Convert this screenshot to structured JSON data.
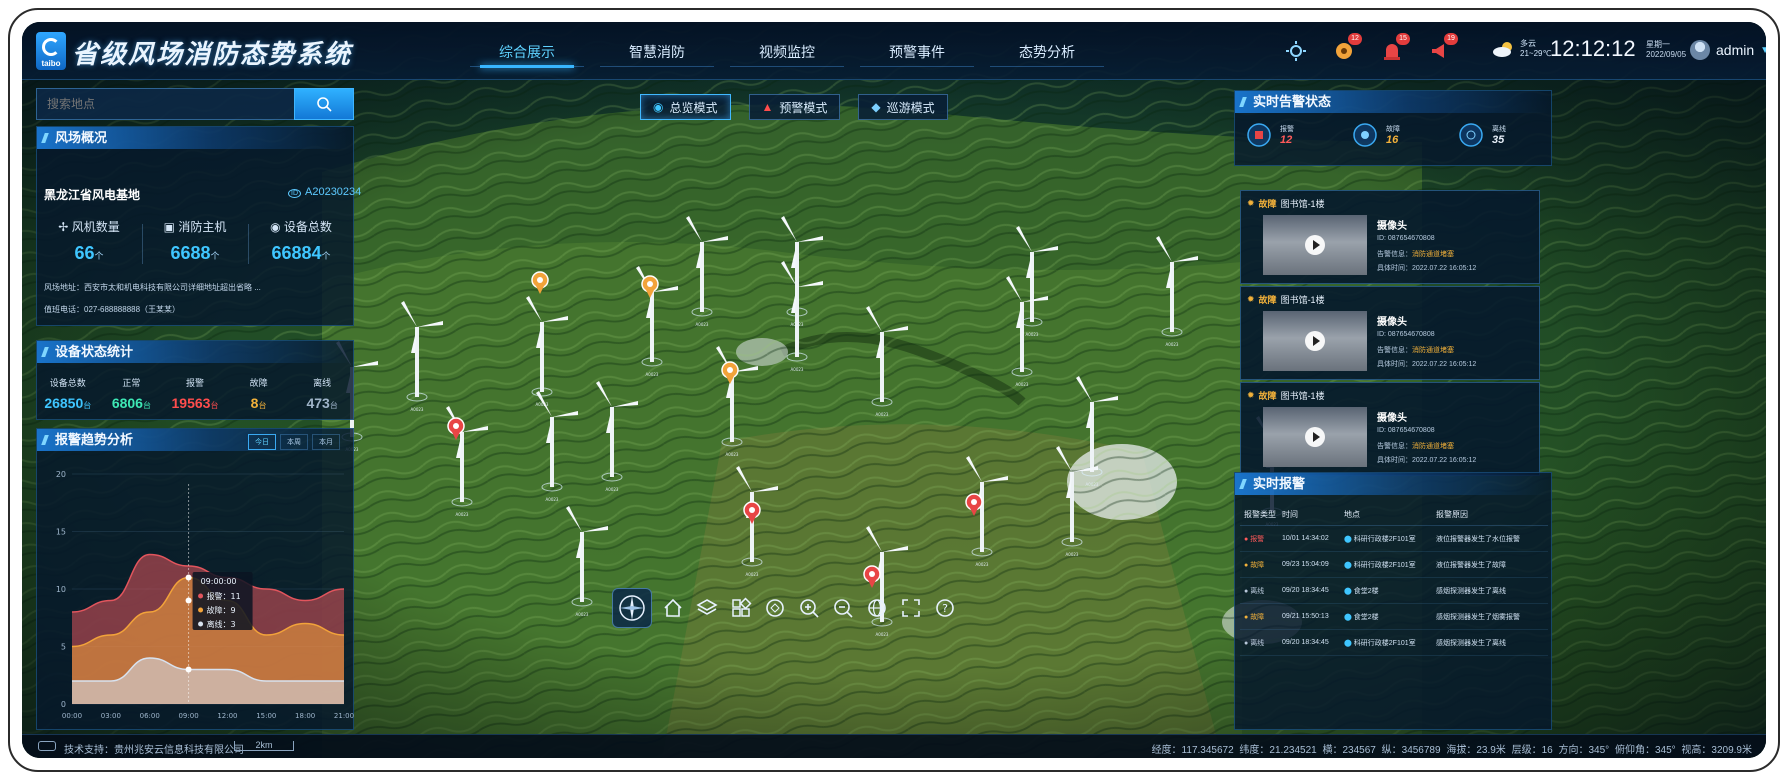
{
  "app": {
    "logo_text": "taibo",
    "title": "省级风场消防态势系统"
  },
  "nav": {
    "items": [
      {
        "label": "综合展示",
        "active": true
      },
      {
        "label": "智慧消防",
        "active": false
      },
      {
        "label": "视频监控",
        "active": false
      },
      {
        "label": "预警事件",
        "active": false
      },
      {
        "label": "态势分析",
        "active": false
      }
    ]
  },
  "header": {
    "icons": [
      {
        "name": "settings-icon",
        "badge": ""
      },
      {
        "name": "gear-alert-icon",
        "badge": "12"
      },
      {
        "name": "alarm-light-icon",
        "badge": "15"
      },
      {
        "name": "horn-icon",
        "badge": "19"
      }
    ],
    "weather": {
      "icon": "cloud-sun-icon",
      "condition": "多云",
      "temp": "21~29℃"
    },
    "time": "12:12:12",
    "weekday": "星期一",
    "date": "2022/09/05",
    "user": "admin"
  },
  "search": {
    "placeholder": "搜索地点",
    "icon": "search-icon"
  },
  "overview": {
    "title": "风场概况",
    "farm_name": "黑龙江省风电基地",
    "farm_code": "A20230234",
    "stats": [
      {
        "label": "风机数量",
        "value": "66",
        "unit": "个",
        "icon": "turbine-icon"
      },
      {
        "label": "消防主机",
        "value": "6688",
        "unit": "个",
        "icon": "host-icon"
      },
      {
        "label": "设备总数",
        "value": "66884",
        "unit": "个",
        "icon": "device-icon"
      }
    ],
    "address": "风场地址：西安市太和机电科技有限公司详细地址超出省略 ...",
    "phone": "值班电话：027-688888888（王某某）"
  },
  "device_status": {
    "title": "设备状态统计",
    "stats": [
      {
        "label": "设备总数",
        "value": "26850",
        "unit": "台",
        "color": "#3fc6ff"
      },
      {
        "label": "正常",
        "value": "6806",
        "unit": "台",
        "color": "#3ee8b5"
      },
      {
        "label": "报警",
        "value": "19563",
        "unit": "台",
        "color": "#ff4d4d"
      },
      {
        "label": "故障",
        "value": "8",
        "unit": "台",
        "color": "#f2b13a"
      },
      {
        "label": "离线",
        "value": "473",
        "unit": "台",
        "color": "#9fb4c9"
      }
    ]
  },
  "trend": {
    "title": "报警趋势分析",
    "tabs": [
      {
        "label": "今日",
        "active": true
      },
      {
        "label": "本周",
        "active": false
      },
      {
        "label": "本月",
        "active": false
      }
    ]
  },
  "chart_data": {
    "type": "area",
    "x": [
      "00:00",
      "03:00",
      "06:00",
      "09:00",
      "12:00",
      "15:00",
      "18:00",
      "21:00"
    ],
    "ylim": [
      0,
      20
    ],
    "yticks": [
      0,
      5,
      10,
      15,
      20
    ],
    "series": [
      {
        "name": "报警",
        "color": "#e2555d",
        "values": [
          8,
          9,
          13,
          12,
          11,
          10,
          9,
          10
        ]
      },
      {
        "name": "故障",
        "color": "#f2a33a",
        "values": [
          5,
          6,
          8,
          11,
          9,
          6,
          7,
          6
        ]
      },
      {
        "name": "离线",
        "color": "#d8e2ef",
        "values": [
          2,
          2,
          4,
          3,
          3,
          2,
          2,
          2
        ]
      }
    ],
    "tooltip": {
      "time": "09:00:00",
      "items": [
        {
          "name": "报警",
          "value": "11",
          "color": "#e2555d"
        },
        {
          "name": "故障",
          "value": "9",
          "color": "#f2a33a"
        },
        {
          "name": "离线",
          "value": "3",
          "color": "#d8e2ef"
        }
      ]
    }
  },
  "modes": [
    {
      "label": "总览模式",
      "active": true
    },
    {
      "label": "预警模式",
      "active": false
    },
    {
      "label": "巡游模式",
      "active": false
    }
  ],
  "alarm_status": {
    "title": "实时告警状态",
    "items": [
      {
        "label": "报警",
        "value": "12",
        "color": "#ff5a5a"
      },
      {
        "label": "故障",
        "value": "16",
        "color": "#f2b13a"
      },
      {
        "label": "离线",
        "value": "35",
        "color": "#e6eef8"
      }
    ]
  },
  "alarm_cards": [
    {
      "type": "故障",
      "place": "图书馆-1楼",
      "title": "摄像头",
      "id": "ID: 087654670808",
      "info_label": "告警信息：",
      "info": "消防通道堵塞",
      "time": "具体时间：2022.07.22 16:05:12"
    },
    {
      "type": "故障",
      "place": "图书馆-1楼",
      "title": "摄像头",
      "id": "ID: 087654670808",
      "info_label": "告警信息：",
      "info": "消防通道堵塞",
      "time": "具体时间：2022.07.22 16:05:12"
    },
    {
      "type": "故障",
      "place": "图书馆-1楼",
      "title": "摄像头",
      "id": "ID: 087654670808",
      "info_label": "告警信息：",
      "info": "消防通道堵塞",
      "time": "具体时间：2022.07.22 16:05:12"
    }
  ],
  "realtime": {
    "title": "实时报警",
    "headers": [
      "报警类型",
      "时间",
      "地点",
      "报警原因"
    ],
    "rows": [
      {
        "type": "报警",
        "type_color": "#ff5a5a",
        "time": "10/01 14:34:02",
        "place": "科研行政楼2F101室",
        "reason": "液位报警器发生了水位报警"
      },
      {
        "type": "故障",
        "type_color": "#f2b13a",
        "time": "09/23 15:04:09",
        "place": "科研行政楼2F101室",
        "reason": "液位报警器发生了故障"
      },
      {
        "type": "离线",
        "type_color": "#b8c8da",
        "time": "09/20 18:34:45",
        "place": "食堂2楼",
        "reason": "感烟探测器发生了离线"
      },
      {
        "type": "故障",
        "type_color": "#f2b13a",
        "time": "09/21 15:50:13",
        "place": "食堂2楼",
        "reason": "感烟探测器发生了烟雾报警"
      },
      {
        "type": "离线",
        "type_color": "#b8c8da",
        "time": "09/20 18:34:45",
        "place": "科研行政楼2F101室",
        "reason": "感烟探测器发生了离线"
      }
    ]
  },
  "map": {
    "turbine_label": "A0023"
  },
  "tools": [
    "compass-icon",
    "home-icon",
    "layers-icon",
    "grid-icon",
    "measure-icon",
    "zoom-in-icon",
    "zoom-out-icon",
    "globe-icon",
    "fullscreen-icon",
    "help-icon"
  ],
  "footer": {
    "support": "技术支持：贵州兆安云信息科技有限公司",
    "scale": "2km",
    "coords": "经度：117.345672   纬度：21.234521   横：234567   纵：3456789   海拔：23.9米   层级：16   方向：345°   俯仰角：345°   视高：3209.9米"
  }
}
